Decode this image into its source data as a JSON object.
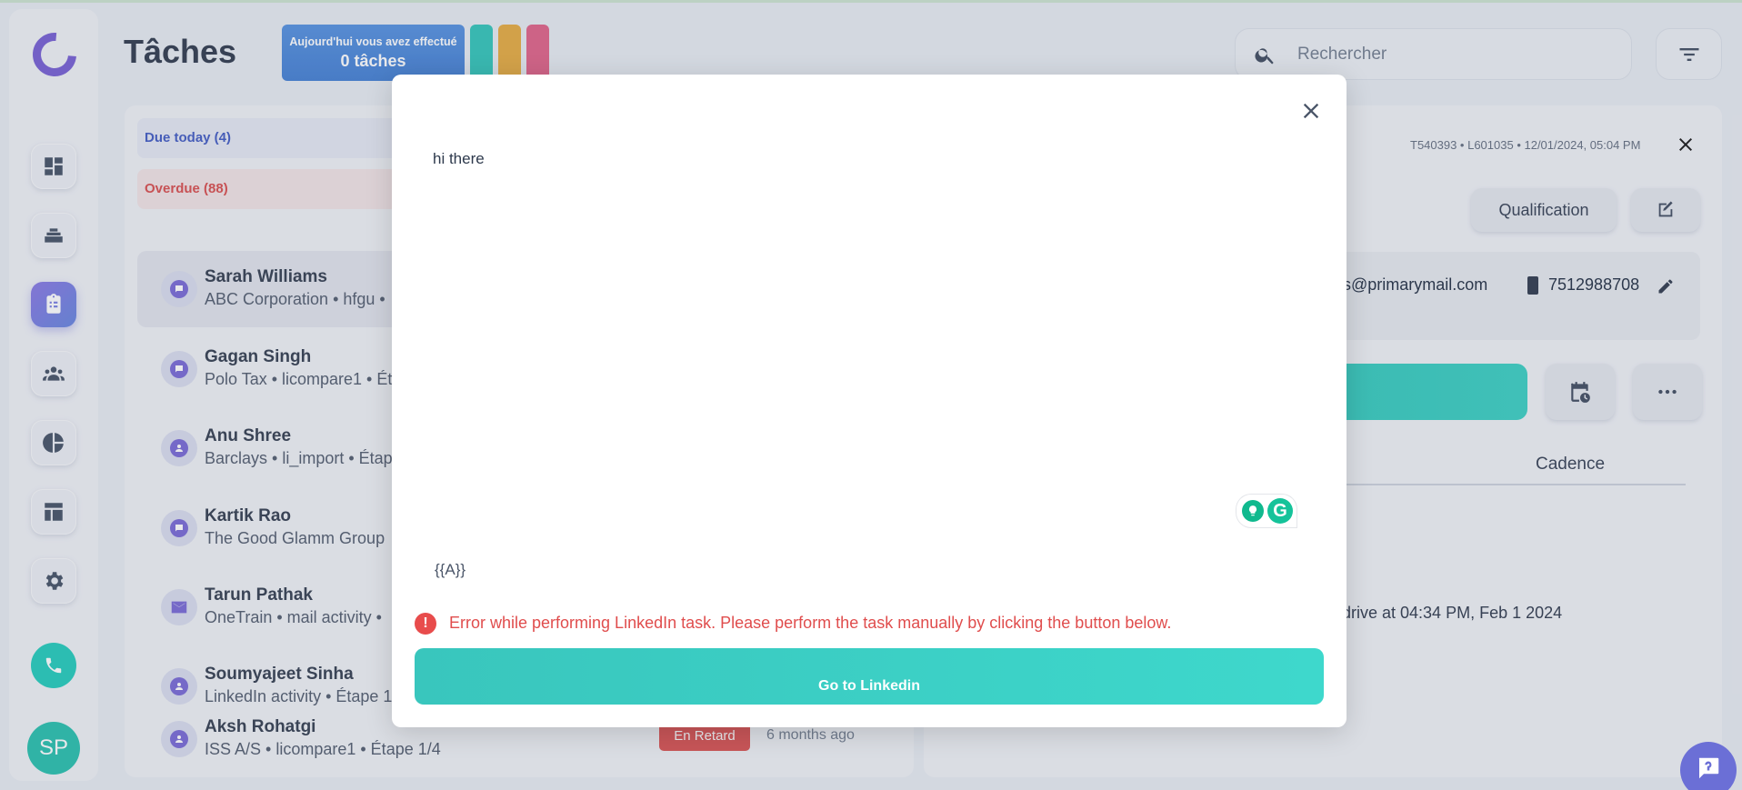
{
  "header": {
    "title": "Tâches",
    "stat_line1": "Aujourd'hui vous avez effectué",
    "stat_line2": "0 tâches"
  },
  "search": {
    "placeholder": "Rechercher"
  },
  "sidebar": {
    "items": [
      {
        "icon": "dashboard-icon"
      },
      {
        "icon": "layers-icon"
      },
      {
        "icon": "tasks-clipboard-icon",
        "active": true
      },
      {
        "icon": "people-icon"
      },
      {
        "icon": "pie-chart-icon"
      },
      {
        "icon": "template-icon"
      },
      {
        "icon": "gear-icon"
      }
    ],
    "avatar_initials": "SP"
  },
  "task_filters": {
    "due_today": "Due today (4)",
    "overdue": "Overdue (88)"
  },
  "tasks": [
    {
      "name": "Sarah Williams",
      "sub": "ABC Corporation • hfgu •",
      "icon": "chat-icon",
      "selected": true
    },
    {
      "name": "Gagan Singh",
      "sub": "Polo Tax • licompare1 • Ét",
      "icon": "chat-icon"
    },
    {
      "name": "Anu Shree",
      "sub": "Barclays • li_import • Étap",
      "icon": "user-icon"
    },
    {
      "name": "Kartik Rao",
      "sub": "The Good Glamm Group",
      "icon": "chat-icon"
    },
    {
      "name": "Tarun Pathak",
      "sub": "OneTrain • mail activity •",
      "icon": "mail-icon"
    },
    {
      "name": "Soumyajeet Sinha",
      "sub": "LinkedIn activity • Étape 1",
      "icon": "user-icon"
    },
    {
      "name": "Aksh Rohatgi",
      "sub": "ISS A/S • licompare1 • Étape 1/4",
      "icon": "user-icon"
    }
  ],
  "last_task_badge": "En Retard",
  "last_task_time": "6 months ago",
  "detail": {
    "meta": "T540393 • L601035 • 12/01/2024, 05:04 PM",
    "qualification_label": "Qualification",
    "email_partial": "ms@primarymail.com",
    "phone": "7512988708",
    "cadence_tab": "Cadence",
    "activity_partial": "drive at 04:34 PM, Feb 1 2024"
  },
  "modal": {
    "message": "hi there",
    "variable": "{{A}}",
    "error": "Error while performing LinkedIn task. Please perform the task manually by clicking the button below.",
    "button_label": "Go to Linkedin",
    "grammarly_letter": "G",
    "error_glyph": "!"
  },
  "colors": {
    "accent_purple": "#7d67d6",
    "teal": "#3ed8cc",
    "error_red": "#e04d4d",
    "stat_blue": "#5d97e2",
    "pill_teal": "#3cc8bd",
    "pill_orange": "#e8b04a",
    "pill_pink": "#e26a8e"
  }
}
